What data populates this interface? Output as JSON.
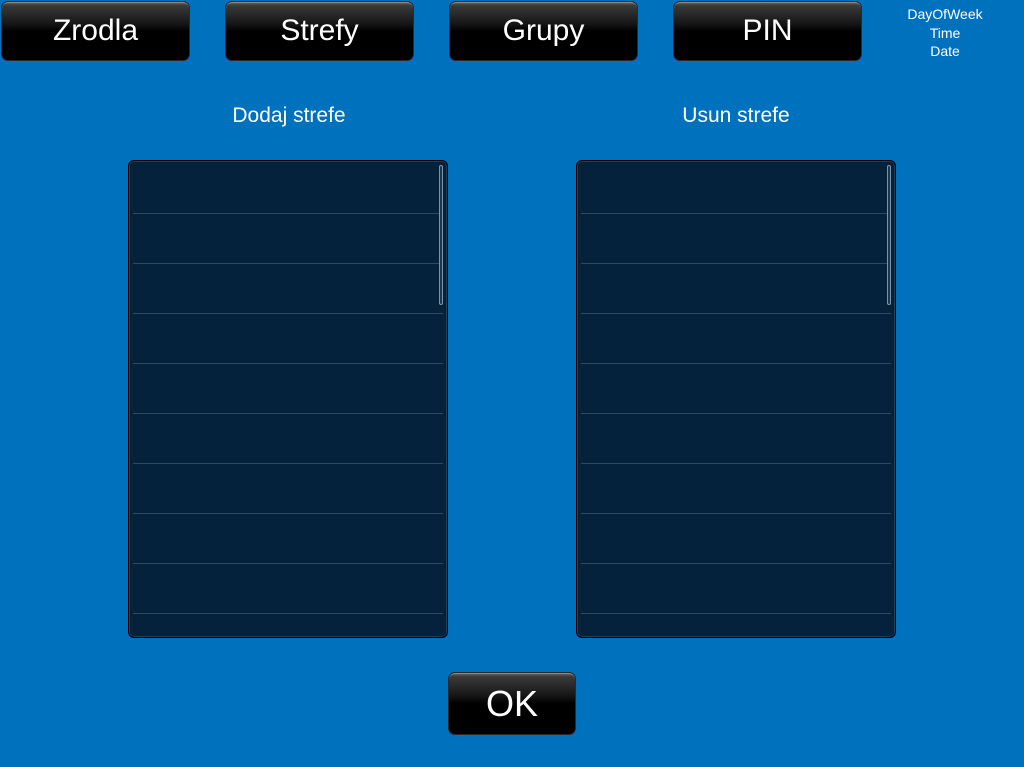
{
  "nav": {
    "sources_label": "Zrodla",
    "zones_label": "Strefy",
    "groups_label": "Grupy",
    "pin_label": "PIN"
  },
  "clock": {
    "day_of_week": "DayOfWeek",
    "time": "Time",
    "date": "Date"
  },
  "add_zone": {
    "title": "Dodaj strefe",
    "items": []
  },
  "remove_zone": {
    "title": "Usun strefe",
    "items": []
  },
  "ok_label": "OK",
  "colors": {
    "background": "#0071bd",
    "list_background": "#04223b",
    "text": "#ffffff"
  }
}
